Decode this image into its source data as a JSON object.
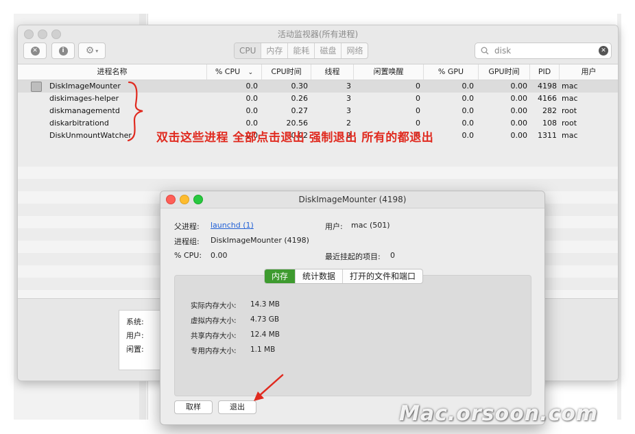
{
  "window": {
    "title": "活动监视器(所有进程)",
    "tabs": [
      "CPU",
      "内存",
      "能耗",
      "磁盘",
      "网络"
    ],
    "active_tab": "CPU",
    "search_value": "disk"
  },
  "table": {
    "columns": [
      "进程名称",
      "% CPU",
      "CPU时间",
      "线程",
      "闲置唤醒",
      "% GPU",
      "GPU时间",
      "PID",
      "用户"
    ],
    "rows": [
      {
        "name": "DiskImageMounter",
        "cpu": "0.0",
        "cpu_time": "0.30",
        "threads": "3",
        "idle_wakeups": "0",
        "gpu": "0.0",
        "gpu_time": "0.00",
        "pid": "4198",
        "user": "mac"
      },
      {
        "name": "diskimages-helper",
        "cpu": "0.0",
        "cpu_time": "0.26",
        "threads": "3",
        "idle_wakeups": "0",
        "gpu": "0.0",
        "gpu_time": "0.00",
        "pid": "4166",
        "user": "mac"
      },
      {
        "name": "diskmanagementd",
        "cpu": "0.0",
        "cpu_time": "0.27",
        "threads": "3",
        "idle_wakeups": "0",
        "gpu": "0.0",
        "gpu_time": "0.00",
        "pid": "282",
        "user": "root"
      },
      {
        "name": "diskarbitrationd",
        "cpu": "0.0",
        "cpu_time": "20.56",
        "threads": "2",
        "idle_wakeups": "0",
        "gpu": "0.0",
        "gpu_time": "0.00",
        "pid": "108",
        "user": "root"
      },
      {
        "name": "DiskUnmountWatcher",
        "cpu": "0.0",
        "cpu_time": "0.02",
        "threads": "2",
        "idle_wakeups": "0",
        "gpu": "0.0",
        "gpu_time": "0.00",
        "pid": "1311",
        "user": "mac"
      }
    ]
  },
  "annotation": "双击这些进程 全部点击退出 强制退出 所有的都退出",
  "bottom_panel": {
    "labels": [
      "系统:",
      "用户:",
      "闲置:"
    ]
  },
  "dialog": {
    "title": "DiskImageMounter (4198)",
    "parent_label": "父进程:",
    "parent_value": "launchd (1)",
    "user_label": "用户:",
    "user_value": "mac (501)",
    "group_label": "进程组:",
    "group_value": "DiskImageMounter (4198)",
    "cpu_label": "% CPU:",
    "cpu_value": "0.00",
    "recent_label": "最近挂起的项目:",
    "recent_value": "0",
    "tabs": [
      "内存",
      "统计数据",
      "打开的文件和端口"
    ],
    "active_tab": "内存",
    "memory": [
      {
        "label": "实际内存大小:",
        "value": "14.3 MB"
      },
      {
        "label": "虚拟内存大小:",
        "value": "4.73 GB"
      },
      {
        "label": "共享内存大小:",
        "value": "12.4 MB"
      },
      {
        "label": "专用内存大小:",
        "value": "1.1 MB"
      }
    ],
    "sample_button": "取样",
    "quit_button": "退出"
  },
  "watermark": "Mac.orsoon.com",
  "colors": {
    "annotation_red": "#e02a1f",
    "active_tab_green": "#3e9b2f",
    "link_blue": "#1f5fd6"
  }
}
